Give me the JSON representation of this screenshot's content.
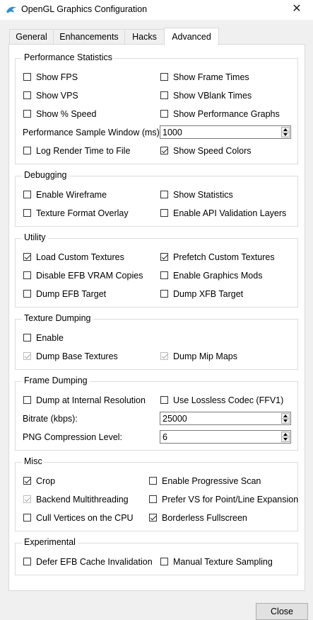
{
  "window": {
    "title": "OpenGL Graphics Configuration",
    "close_symbol": "✕"
  },
  "tabs": [
    "General",
    "Enhancements",
    "Hacks",
    "Advanced"
  ],
  "active_tab": "Advanced",
  "groups": {
    "performance": {
      "title": "Performance Statistics",
      "show_fps": "Show FPS",
      "show_frame_times": "Show Frame Times",
      "show_vps": "Show VPS",
      "show_vblank_times": "Show VBlank Times",
      "show_speed": "Show % Speed",
      "show_perf_graphs": "Show Performance Graphs",
      "sample_window_label": "Performance Sample Window (ms):",
      "sample_window_value": "1000",
      "log_render_time": "Log Render Time to File",
      "show_speed_colors": "Show Speed Colors"
    },
    "debugging": {
      "title": "Debugging",
      "enable_wireframe": "Enable Wireframe",
      "show_statistics": "Show Statistics",
      "texture_format_overlay": "Texture Format Overlay",
      "enable_api_validation": "Enable API Validation Layers"
    },
    "utility": {
      "title": "Utility",
      "load_custom_textures": "Load Custom Textures",
      "prefetch_custom_textures": "Prefetch Custom Textures",
      "disable_efb_vram": "Disable EFB VRAM Copies",
      "enable_graphics_mods": "Enable Graphics Mods",
      "dump_efb_target": "Dump EFB Target",
      "dump_xfb_target": "Dump XFB Target"
    },
    "texture_dumping": {
      "title": "Texture Dumping",
      "enable": "Enable",
      "dump_base_textures": "Dump Base Textures",
      "dump_mip_maps": "Dump Mip Maps"
    },
    "frame_dumping": {
      "title": "Frame Dumping",
      "dump_internal_res": "Dump at Internal Resolution",
      "lossless_codec": "Use Lossless Codec (FFV1)",
      "bitrate_label": "Bitrate (kbps):",
      "bitrate_value": "25000",
      "png_level_label": "PNG Compression Level:",
      "png_level_value": "6"
    },
    "misc": {
      "title": "Misc",
      "crop": "Crop",
      "progressive_scan": "Enable Progressive Scan",
      "backend_multithreading": "Backend Multithreading",
      "prefer_vs": "Prefer VS for Point/Line Expansion",
      "cull_vertices": "Cull Vertices on the CPU",
      "borderless_fullscreen": "Borderless Fullscreen"
    },
    "experimental": {
      "title": "Experimental",
      "defer_efb": "Defer EFB Cache Invalidation",
      "manual_texture_sampling": "Manual Texture Sampling"
    }
  },
  "buttons": {
    "close": "Close"
  }
}
